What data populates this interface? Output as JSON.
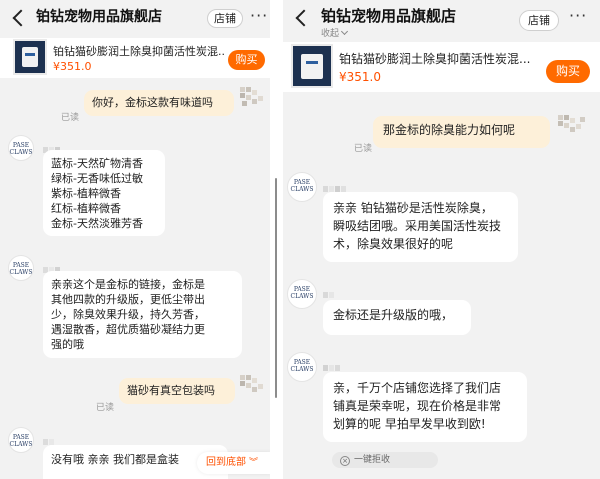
{
  "shop": {
    "name": "铂钻宠物用品旗舰店",
    "subtitle": "收起",
    "shop_button": "店铺",
    "more": "···"
  },
  "product": {
    "title": "铂钻猫砂膨润土除臭抑菌活性炭混...",
    "price": "¥351.0",
    "buy_label": "购买"
  },
  "status": {
    "read": "已读"
  },
  "avatar_text": "PASE CLAWS",
  "left_messages": [
    {
      "from": "me",
      "text": "你好，金标这款有味道吗"
    },
    {
      "from": "shop",
      "text": "蓝标-天然矿物清香\n绿标-无香味低过敏\n紫标-植粹微香\n红标-植粹微香\n金标-天然淡雅芳香"
    },
    {
      "from": "shop",
      "text": "亲亲这个是金标的链接，金标是\n其他四款的升级版，更低尘带出\n少，除臭效果升级，持久芳香，\n遇湿散香，超优质猫砂凝结力更\n强的哦"
    },
    {
      "from": "me",
      "text": "猫砂有真空包装吗"
    },
    {
      "from": "shop",
      "text": "没有哦 亲亲 我们都是盒装"
    }
  ],
  "right_messages": [
    {
      "from": "me",
      "text": "那金标的除臭能力如何呢"
    },
    {
      "from": "shop",
      "text": "亲亲 铂钻猫砂是活性炭除臭，\n瞬吸结团哦。采用美国活性炭技\n术，除臭效果很好的呢"
    },
    {
      "from": "shop",
      "text": "金标还是升级版的哦，"
    },
    {
      "from": "shop",
      "text": "亲，千万个店铺您选择了我们店\n铺真是荣幸呢，现在价格是非常\n划算的呢  早拍早发早收到欧!"
    }
  ],
  "scroll_to_bottom": {
    "label": "回到底部",
    "icon": "double-chevron-down-icon"
  },
  "reject_chip": {
    "label": "一键拒收",
    "icon": "close-circle-icon"
  },
  "colors": {
    "accent": "#ff5000",
    "buy_button": "#ff6a00",
    "my_bubble": "#fdf0d9",
    "background": "#f2f2f2"
  }
}
